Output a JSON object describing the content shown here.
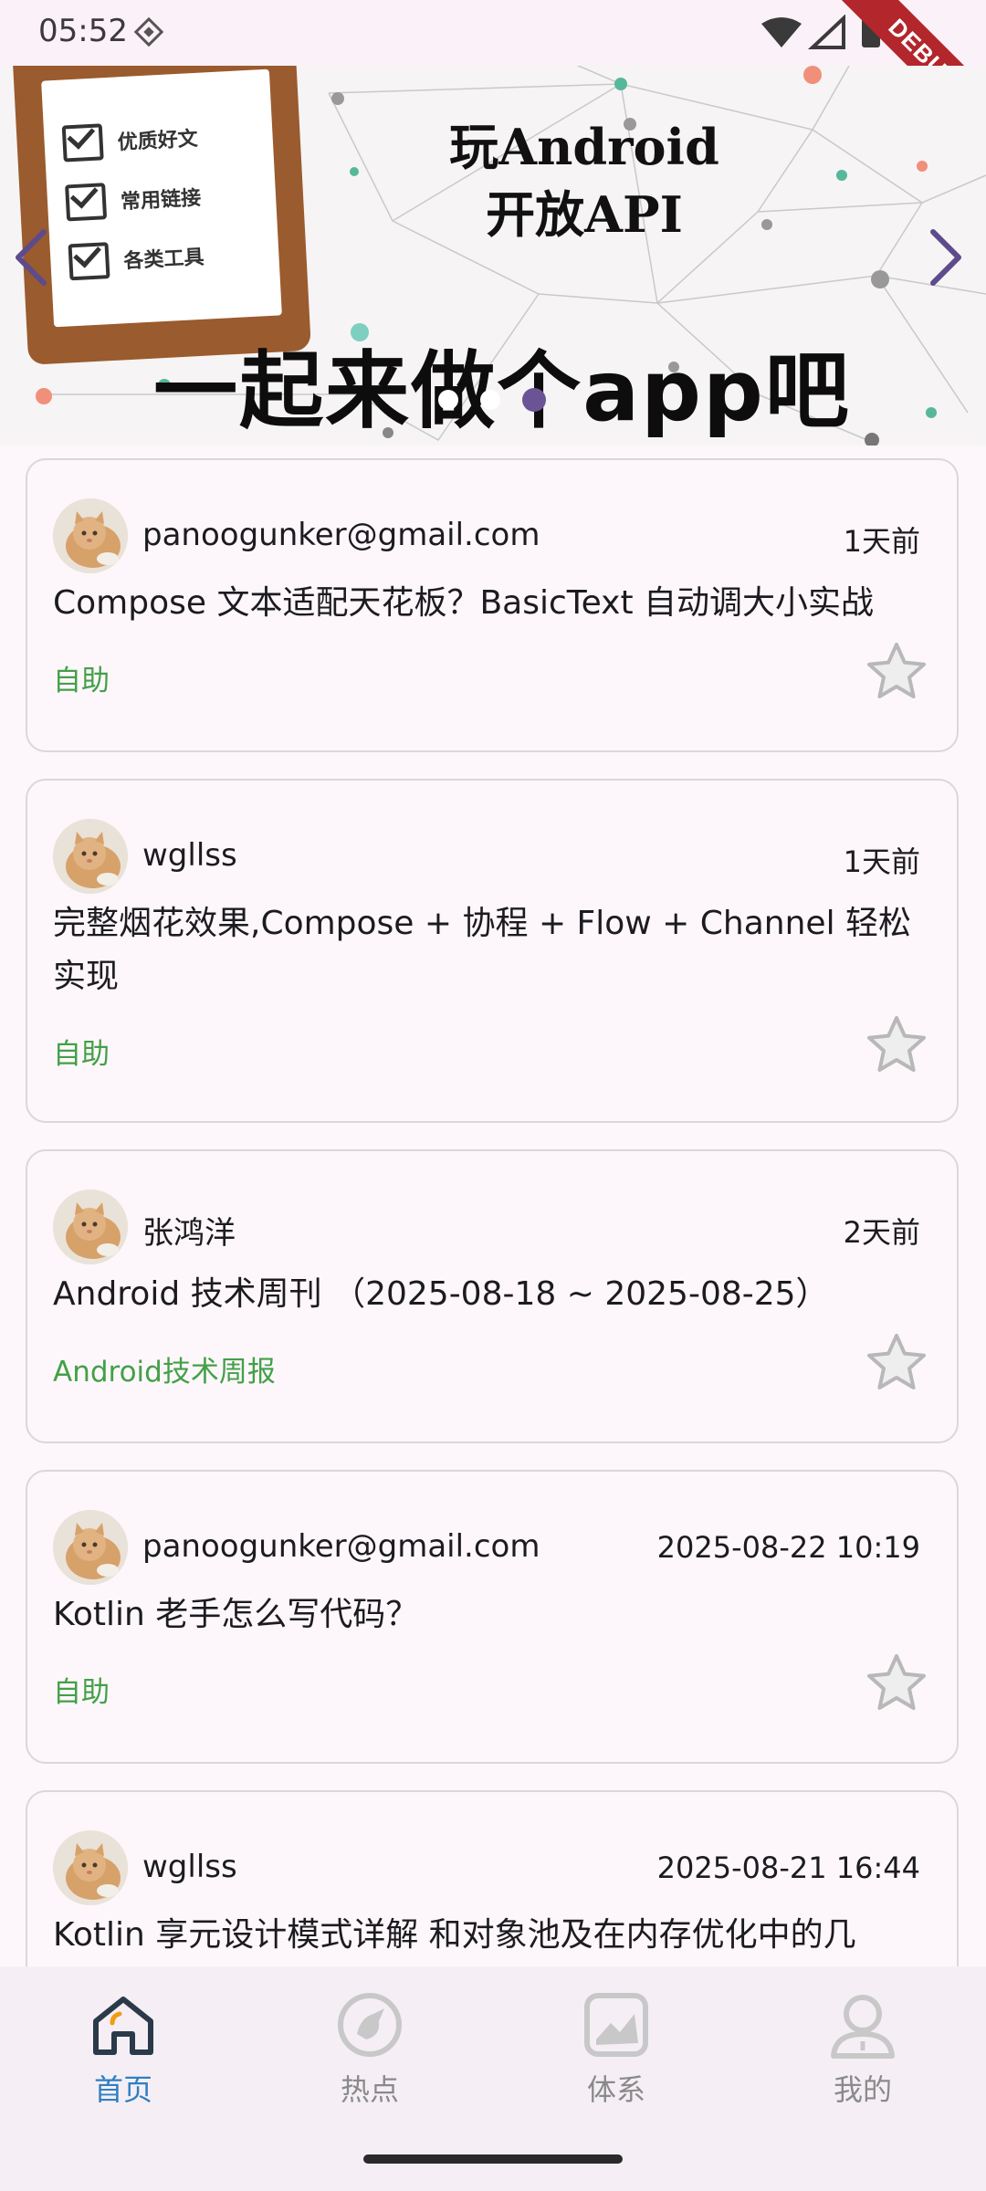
{
  "status_bar": {
    "time": "05:52",
    "debug_label": "DEBUG"
  },
  "banner": {
    "title_line1": "玩Android",
    "title_line2": "开放API",
    "slogan": "一起来做个app吧",
    "checklist": [
      "优质好文",
      "常用链接",
      "各类工具"
    ],
    "active_dot": 2,
    "dot_count": 3
  },
  "articles": [
    {
      "author": "panoogunker@gmail.com",
      "time": "1天前",
      "title": "Compose 文本适配天花板？BasicText 自动调大小实战",
      "chapter": "自助"
    },
    {
      "author": "wgllss",
      "time": "1天前",
      "title": "完整烟花效果,Compose + 协程 + Flow + Channel 轻松实现",
      "chapter": "自助"
    },
    {
      "author": "张鸿洋",
      "time": "2天前",
      "title": "Android 技术周刊 （2025-08-18 ~ 2025-08-25）",
      "chapter": "Android技术周报"
    },
    {
      "author": "panoogunker@gmail.com",
      "time": "2025-08-22 10:19",
      "title": "Kotlin 老手怎么写代码？",
      "chapter": "自助"
    },
    {
      "author": "wgllss",
      "time": "2025-08-21 16:44",
      "title": "Kotlin 享元设计模式详解 和对象池及在内存优化中的几",
      "chapter": ""
    }
  ],
  "nav": {
    "items": [
      {
        "label": "首页",
        "icon": "home-icon"
      },
      {
        "label": "热点",
        "icon": "hot-icon"
      },
      {
        "label": "体系",
        "icon": "system-icon"
      },
      {
        "label": "我的",
        "icon": "profile-icon"
      }
    ],
    "active_index": 0
  },
  "colors": {
    "accent": "#2f7fc3",
    "chapter": "#43a047",
    "indicator": "#6a5496",
    "debug": "#b3262b"
  }
}
